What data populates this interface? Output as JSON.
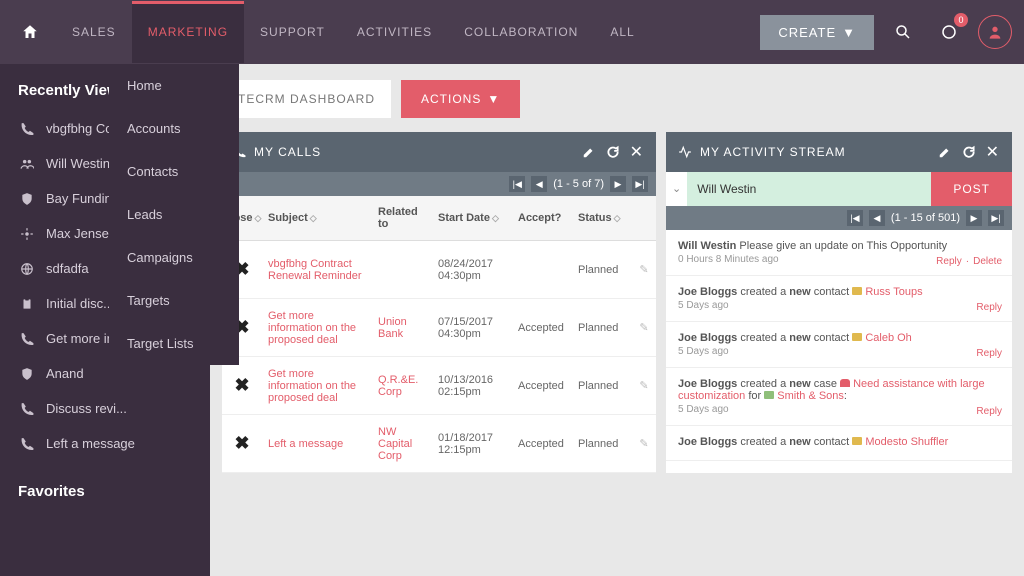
{
  "nav": {
    "items": [
      "SALES",
      "MARKETING",
      "SUPPORT",
      "ACTIVITIES",
      "COLLABORATION",
      "ALL"
    ],
    "active": "MARKETING",
    "create": "CREATE",
    "notif_count": "0"
  },
  "dropdown": [
    "Home",
    "Accounts",
    "Contacts",
    "Leads",
    "Campaigns",
    "Targets",
    "Target Lists"
  ],
  "sidebar": {
    "recent_title": "Recently Viewed",
    "items": [
      {
        "icon": "phone",
        "label": "vbgfbhg Cont..."
      },
      {
        "icon": "users",
        "label": "Will Westin"
      },
      {
        "icon": "shield",
        "label": "Bay Funding Co..."
      },
      {
        "icon": "target",
        "label": "Max Jensen"
      },
      {
        "icon": "globe",
        "label": "sdfadfa"
      },
      {
        "icon": "clipboard",
        "label": "Initial disc..."
      },
      {
        "icon": "phone",
        "label": "Get more inf.."
      },
      {
        "icon": "shield",
        "label": "Anand"
      },
      {
        "icon": "phone",
        "label": "Discuss revi..."
      },
      {
        "icon": "phone",
        "label": "Left a message"
      }
    ],
    "favorites": "Favorites"
  },
  "topbar": {
    "dashboard": "TECRM DASHBOARD",
    "actions": "ACTIONS"
  },
  "calls": {
    "title": "MY CALLS",
    "pager": "(1 - 5 of 7)",
    "headers": {
      "close": "Close",
      "subject": "Subject",
      "related": "Related to",
      "date": "Start Date",
      "accept": "Accept?",
      "status": "Status"
    },
    "rows": [
      {
        "subject": "vbgfbhg Contract Renewal Reminder",
        "related": "",
        "date": "08/24/2017 04:30pm",
        "accept": "",
        "status": "Planned"
      },
      {
        "subject": "Get more information on the proposed deal",
        "related": "Union Bank",
        "date": "07/15/2017 04:30pm",
        "accept": "Accepted",
        "status": "Planned"
      },
      {
        "subject": "Get more information on the proposed deal",
        "related": "Q.R.&E. Corp",
        "date": "10/13/2016 02:15pm",
        "accept": "Accepted",
        "status": "Planned"
      },
      {
        "subject": "Left a message",
        "related": "NW Capital Corp",
        "date": "01/18/2017 12:15pm",
        "accept": "Accepted",
        "status": "Planned"
      }
    ]
  },
  "stream": {
    "title": "MY ACTIVITY STREAM",
    "compose_value": "Will Westin",
    "post": "POST",
    "pager": "(1 - 15 of 501)",
    "items": [
      {
        "prefix": "Will Westin",
        "body": " Please give an update on This Opportunity",
        "meta": "0 Hours 8 Minutes ago",
        "actions": [
          "Reply",
          "Delete"
        ]
      },
      {
        "prefix": "Joe Bloggs",
        "body1": " created a ",
        "bold": "new",
        "body2": " contact ",
        "chip": "mail",
        "link": "Russ Toups",
        "meta": "5 Days ago",
        "actions": [
          "Reply"
        ]
      },
      {
        "prefix": "Joe Bloggs",
        "body1": " created a ",
        "bold": "new",
        "body2": " contact ",
        "chip": "mail",
        "link": "Caleb Oh",
        "meta": "5 Days ago",
        "actions": [
          "Reply"
        ]
      },
      {
        "prefix": "Joe Bloggs",
        "body1": " created a ",
        "bold": "new",
        "body2": " case ",
        "chip": "case",
        "link": "Need assistance with large customization",
        "suffix": " for ",
        "chip2": "acc",
        "link2": "Smith & Sons",
        "text2": ":",
        "meta": "5 Days ago",
        "actions": [
          "Reply"
        ]
      },
      {
        "prefix": "Joe Bloggs",
        "body1": " created a ",
        "bold": "new",
        "body2": " contact ",
        "chip": "mail",
        "link": "Modesto Shuffler",
        "meta": "",
        "actions": []
      }
    ]
  }
}
